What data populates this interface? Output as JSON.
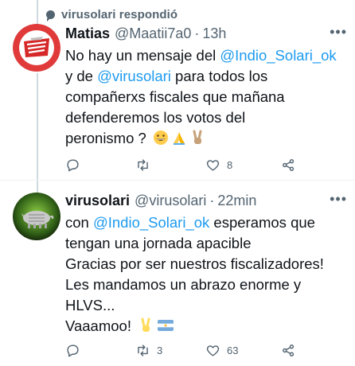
{
  "reply_context": {
    "text": "virusolari respondió"
  },
  "tweets": [
    {
      "name": "Matias",
      "handle": "@Maatii7a0",
      "separator": "·",
      "time": "13h",
      "lines": [
        [
          "No hay un mensaje del ",
          "@Indio_Solari_ok"
        ],
        [
          "y de ",
          "@virusolari",
          " para todos los"
        ],
        [
          "compañerxs fiscales que mañana"
        ],
        [
          "defenderemos los votos del"
        ],
        [
          "peronismo ? "
        ]
      ],
      "emojis": [
        "grinning-face-emoji",
        "folded-hands-emoji",
        "victory-hand-emoji"
      ],
      "actions": {
        "reply": "",
        "retweet": "",
        "like": "8",
        "share": ""
      }
    },
    {
      "name": "virusolari",
      "handle": "@virusolari",
      "separator": "·",
      "time": "22min",
      "lines": [
        [
          "con ",
          "@Indio_Solari_ok",
          " esperamos que"
        ],
        [
          "tengan una jornada apacible"
        ],
        [
          "Gracias por ser nuestros fiscalizadores!"
        ],
        [
          "Les mandamos un abrazo enorme y"
        ],
        [
          "HLVS..."
        ],
        [
          "Vaaamoo! "
        ]
      ],
      "emojis": [
        "victory-hand-emoji",
        "argentina-flag-emoji"
      ],
      "actions": {
        "reply": "",
        "retweet": "3",
        "like": "63",
        "share": ""
      }
    }
  ],
  "icons": {
    "more": "more-icon",
    "reply": "reply-icon",
    "retweet": "retweet-icon",
    "like": "like-icon",
    "share": "share-icon"
  },
  "colors": {
    "mention": "#1d9bf0",
    "secondary_text": "#536471",
    "thread_line": "#cfd9de"
  }
}
